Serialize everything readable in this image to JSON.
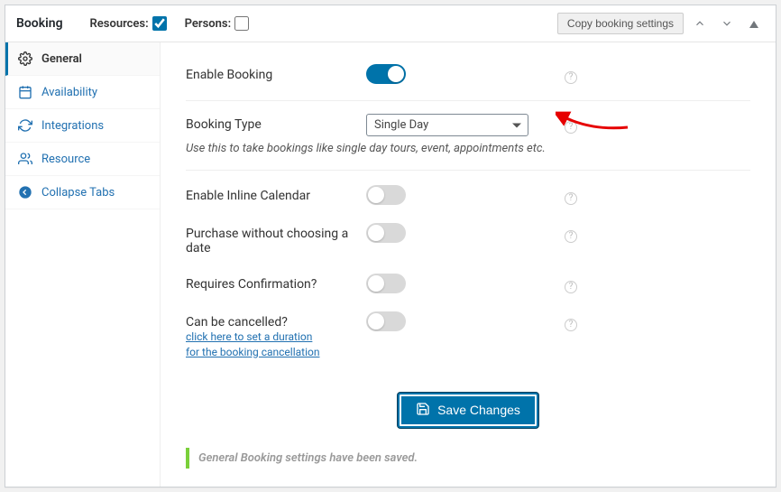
{
  "panel": {
    "title": "Booking"
  },
  "header": {
    "resources_label": "Resources:",
    "resources_checked": true,
    "persons_label": "Persons:",
    "persons_checked": false,
    "copy_button": "Copy booking settings"
  },
  "sidebar": {
    "items": [
      {
        "label": "General",
        "icon": "gear",
        "active": true
      },
      {
        "label": "Availability",
        "icon": "calendar"
      },
      {
        "label": "Integrations",
        "icon": "refresh"
      },
      {
        "label": "Resource",
        "icon": "people"
      },
      {
        "label": "Collapse Tabs",
        "icon": "arrow-left"
      }
    ]
  },
  "form": {
    "enable_booking": {
      "label": "Enable Booking",
      "value": true
    },
    "booking_type": {
      "label": "Booking Type",
      "value": "Single Day",
      "hint": "Use this to take bookings like single day tours, event, appointments etc."
    },
    "inline_calendar": {
      "label": "Enable Inline Calendar",
      "value": false
    },
    "purchase_without_date": {
      "label": "Purchase without choosing a date",
      "value": false
    },
    "requires_confirmation": {
      "label": "Requires Confirmation?",
      "value": false
    },
    "can_cancel": {
      "label": "Can be cancelled?",
      "value": false,
      "link1": "click here to set a duration",
      "link2": "for the booking cancellation"
    }
  },
  "actions": {
    "save": "Save Changes"
  },
  "notice": {
    "text": "General Booking settings have been saved."
  }
}
